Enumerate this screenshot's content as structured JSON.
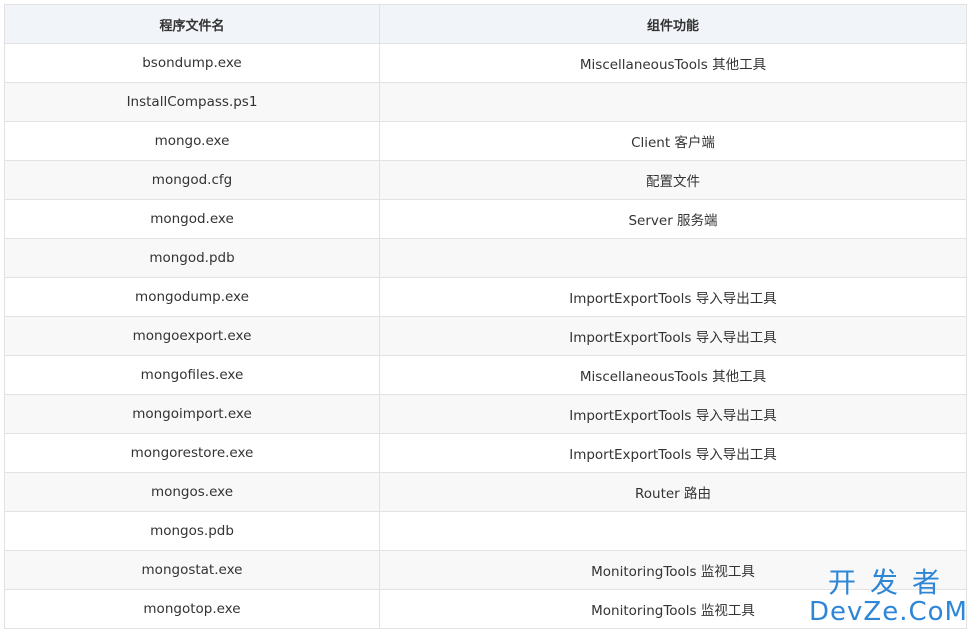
{
  "table": {
    "headers": [
      "程序文件名",
      "组件功能"
    ],
    "rows": [
      {
        "file": "bsondump.exe",
        "func": "MiscellaneousTools 其他工具"
      },
      {
        "file": "InstallCompass.ps1",
        "func": ""
      },
      {
        "file": "mongo.exe",
        "func": "Client 客户端"
      },
      {
        "file": "mongod.cfg",
        "func": "配置文件"
      },
      {
        "file": "mongod.exe",
        "func": "Server 服务端"
      },
      {
        "file": "mongod.pdb",
        "func": ""
      },
      {
        "file": "mongodump.exe",
        "func": "ImportExportTools 导入导出工具"
      },
      {
        "file": "mongoexport.exe",
        "func": "ImportExportTools 导入导出工具"
      },
      {
        "file": "mongofiles.exe",
        "func": "MiscellaneousTools 其他工具"
      },
      {
        "file": "mongoimport.exe",
        "func": "ImportExportTools 导入导出工具"
      },
      {
        "file": "mongorestore.exe",
        "func": "ImportExportTools 导入导出工具"
      },
      {
        "file": "mongos.exe",
        "func": "Router 路由"
      },
      {
        "file": "mongos.pdb",
        "func": ""
      },
      {
        "file": "mongostat.exe",
        "func": "MonitoringTools 监视工具"
      },
      {
        "file": "mongotop.exe",
        "func": "MonitoringTools 监视工具"
      }
    ]
  },
  "watermark": {
    "cn": "开发者",
    "en": "DevZe.CoM"
  }
}
